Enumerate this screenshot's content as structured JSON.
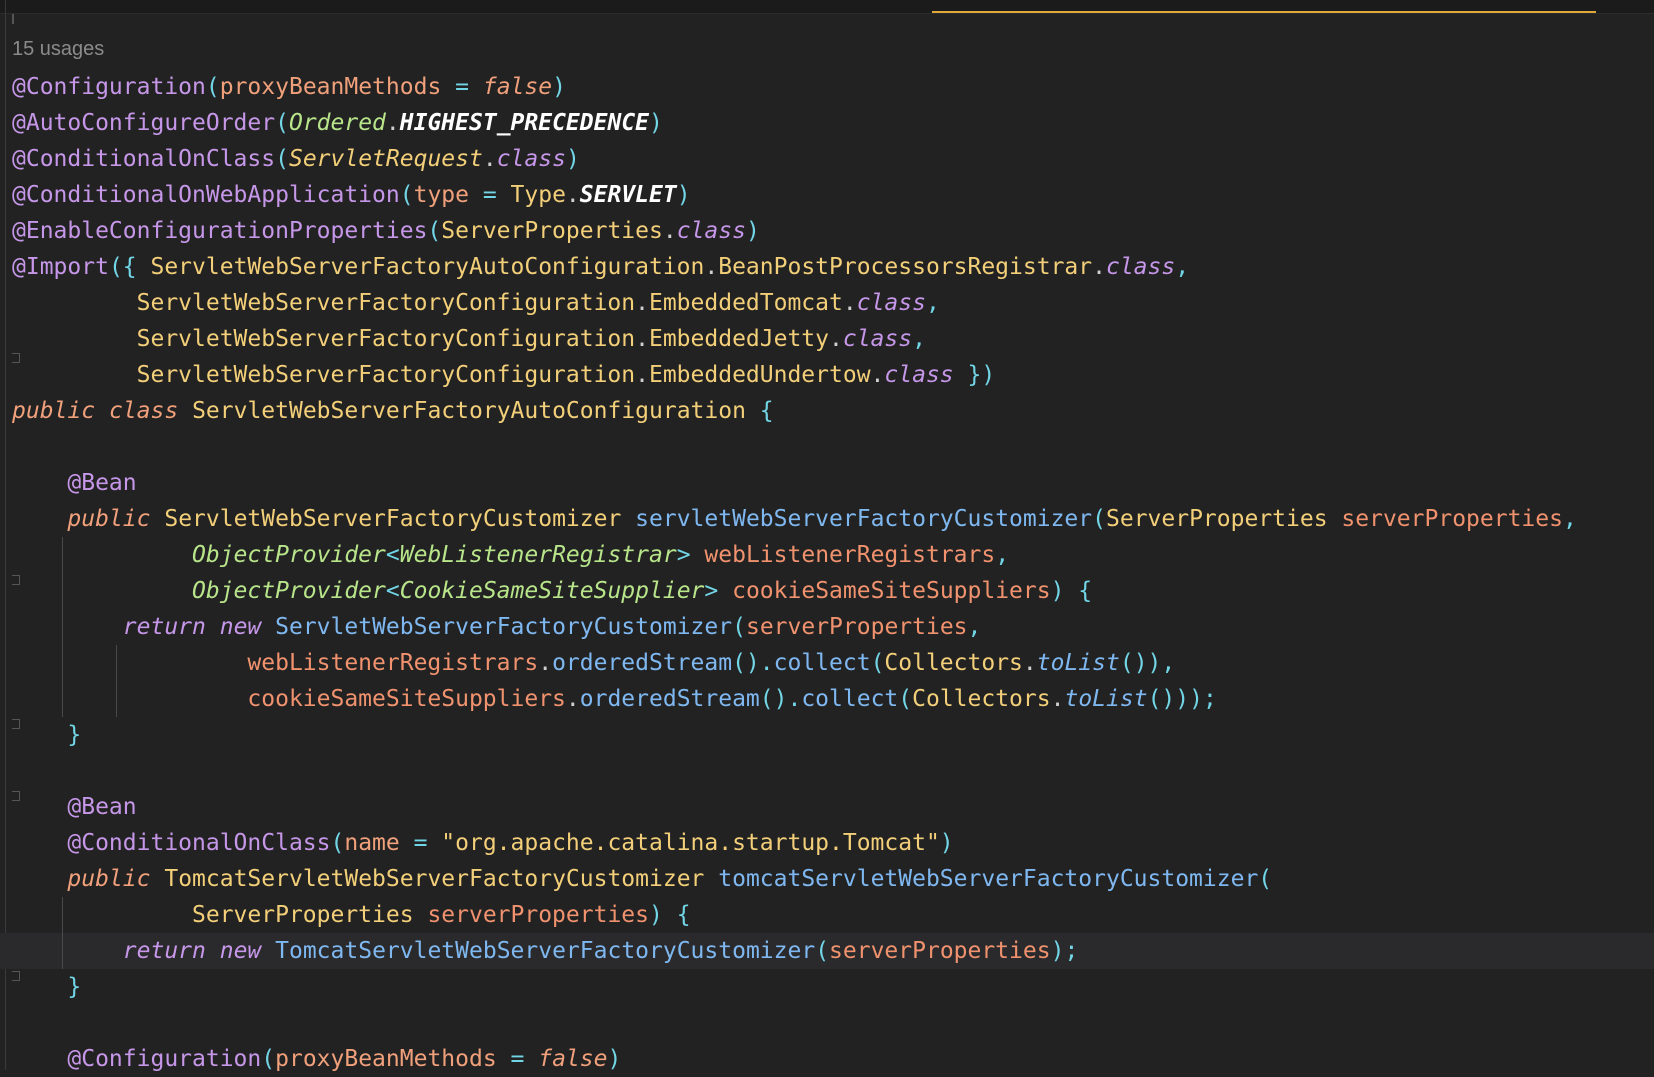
{
  "editor": {
    "usages_hint": "15 usages",
    "accent_color": "#e0a83a",
    "background": "#222223"
  },
  "code": {
    "line1": {
      "a": "@Configuration",
      "b": "(",
      "c": "proxyBeanMethods",
      "d": " = ",
      "e": "false",
      "f": ")"
    },
    "line2": {
      "a": "@AutoConfigureOrder",
      "b": "(",
      "c": "Ordered",
      "d": ".",
      "e": "HIGHEST_PRECEDENCE",
      "f": ")"
    },
    "line3": {
      "a": "@ConditionalOnClass",
      "b": "(",
      "c": "ServletRequest",
      "d": ".",
      "e": "class",
      "f": ")"
    },
    "line4": {
      "a": "@ConditionalOnWebApplication",
      "b": "(",
      "c": "type",
      "d": " = ",
      "e": "Type",
      "f": ".",
      "g": "SERVLET",
      "h": ")"
    },
    "line5": {
      "a": "@EnableConfigurationProperties",
      "b": "(",
      "c": "ServerProperties",
      "d": ".",
      "e": "class",
      "f": ")"
    },
    "line6": {
      "a": "@Import",
      "b": "({ ",
      "c": "ServletWebServerFactoryAutoConfiguration",
      "d": ".",
      "e": "BeanPostProcessorsRegistrar",
      "f": ".",
      "g": "class",
      "h": ","
    },
    "line7": {
      "indent": "         ",
      "a": "ServletWebServerFactoryConfiguration",
      "b": ".",
      "c": "EmbeddedTomcat",
      "d": ".",
      "e": "class",
      "f": ","
    },
    "line8": {
      "indent": "         ",
      "a": "ServletWebServerFactoryConfiguration",
      "b": ".",
      "c": "EmbeddedJetty",
      "d": ".",
      "e": "class",
      "f": ","
    },
    "line9": {
      "indent": "         ",
      "a": "ServletWebServerFactoryConfiguration",
      "b": ".",
      "c": "EmbeddedUndertow",
      "d": ".",
      "e": "class",
      "f": " })"
    },
    "line10": {
      "a": "public",
      "b": " ",
      "c": "class",
      "d": " ",
      "e": "ServletWebServerFactoryAutoConfiguration",
      "f": " {"
    },
    "line12": {
      "indent": "    ",
      "a": "@Bean"
    },
    "line13": {
      "indent": "    ",
      "a": "public",
      "b": " ",
      "c": "ServletWebServerFactoryCustomizer",
      "d": " ",
      "e": "servletWebServerFactoryCustomizer",
      "f": "(",
      "g": "ServerProperties",
      "h": " ",
      "i": "serverProperties",
      "j": ","
    },
    "line14": {
      "indent": "             ",
      "a": "ObjectProvider",
      "b": "<",
      "c": "WebListenerRegistrar",
      "d": ">",
      "e": " ",
      "f": "webListenerRegistrars",
      "g": ","
    },
    "line15": {
      "indent": "             ",
      "a": "ObjectProvider",
      "b": "<",
      "c": "CookieSameSiteSupplier",
      "d": ">",
      "e": " ",
      "f": "cookieSameSiteSuppliers",
      "g": ") {"
    },
    "line16": {
      "indent": "        ",
      "a": "return",
      "b": " ",
      "c": "new",
      "d": " ",
      "e": "ServletWebServerFactoryCustomizer",
      "f": "(",
      "g": "serverProperties",
      "h": ","
    },
    "line17": {
      "indent": "                 ",
      "a": "webListenerRegistrars",
      "b": ".",
      "c": "orderedStream",
      "d": "().",
      "e": "collect",
      "f": "(",
      "g": "Collectors",
      "h": ".",
      "i": "toList",
      "j": "()),"
    },
    "line18": {
      "indent": "                 ",
      "a": "cookieSameSiteSuppliers",
      "b": ".",
      "c": "orderedStream",
      "d": "().",
      "e": "collect",
      "f": "(",
      "g": "Collectors",
      "h": ".",
      "i": "toList",
      "j": "()));"
    },
    "line19": {
      "indent": "    ",
      "a": "}"
    },
    "line21": {
      "indent": "    ",
      "a": "@Bean"
    },
    "line22": {
      "indent": "    ",
      "a": "@ConditionalOnClass",
      "b": "(",
      "c": "name",
      "d": " = ",
      "e": "\"org.apache.catalina.startup.Tomcat\"",
      "f": ")"
    },
    "line23": {
      "indent": "    ",
      "a": "public",
      "b": " ",
      "c": "TomcatServletWebServerFactoryCustomizer",
      "d": " ",
      "e": "tomcatServletWebServerFactoryCustomizer",
      "f": "("
    },
    "line24": {
      "indent": "             ",
      "a": "ServerProperties",
      "b": " ",
      "c": "serverProperties",
      "d": ") {"
    },
    "line25": {
      "indent": "        ",
      "a": "return",
      "b": " ",
      "c": "new",
      "d": " ",
      "e": "TomcatServletWebServerFactoryCustomizer",
      "f": "(",
      "g": "serverProperties",
      "h": ");"
    },
    "line26": {
      "indent": "    ",
      "a": "}"
    },
    "line28": {
      "indent": "    ",
      "a": "@Configuration",
      "b": "(",
      "c": "proxyBeanMethods",
      "d": " = ",
      "e": "false",
      "f": ")"
    }
  }
}
